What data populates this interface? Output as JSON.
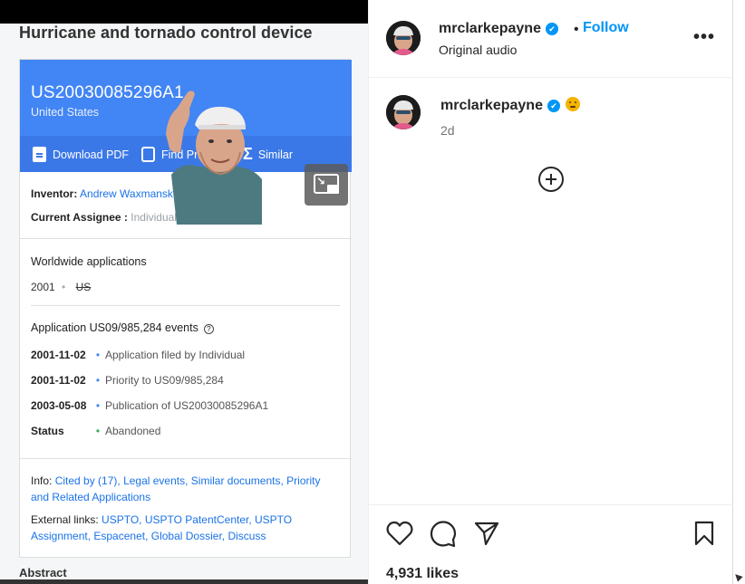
{
  "media": {
    "doc_title": "Hurricane and tornado control device",
    "publication_number": "US20030085296A1",
    "country": "United States",
    "actions": {
      "download_pdf": "Download PDF",
      "find_prior_art": "Find Prior",
      "similar": "Similar"
    },
    "inventor_label": "Inventor:",
    "inventor_value": "Andrew Waxmansk",
    "assignee_label": "Current Assignee :",
    "assignee_value": "Individual",
    "worldwide_title": "Worldwide applications",
    "worldwide_year": "2001",
    "worldwide_dot": "•",
    "worldwide_country": "US",
    "events_title": "Application US09/985,284 events",
    "events_help": "?",
    "events": [
      {
        "date": "2001-11-02",
        "text": "Application filed by Individual"
      },
      {
        "date": "2001-11-02",
        "text": "Priority to US09/985,284"
      },
      {
        "date": "2003-05-08",
        "text": "Publication of US20030085296A1"
      },
      {
        "date": "Status",
        "text": "Abandoned"
      }
    ],
    "event_bullet": "•",
    "info_label": "Info:",
    "info_links": "Cited by (17), Legal events, Similar documents, Priority and Related Applications",
    "external_label": "External links:",
    "external_links": "USPTO, USPTO PatentCenter, USPTO Assignment, Espacenet, Global Dossier, Discuss",
    "abstract_label": "Abstract",
    "icons": {
      "pip": "picture-in-picture-icon",
      "pdf": "pdf-icon",
      "search": "search-icon",
      "sigma": "sigma-icon"
    }
  },
  "post": {
    "username": "mrclarkepayne",
    "verified_mark": "✔",
    "separator": "•",
    "follow_label": "Follow",
    "audio": "Original audio",
    "more_label": "•••",
    "caption_username": "mrclarkepayne",
    "time_ago": "2d",
    "likes": "4,931 likes",
    "icons": {
      "like": "heart-icon",
      "comment": "comment-icon",
      "share": "send-icon",
      "save": "bookmark-icon",
      "add": "plus-circle-icon",
      "emoji": "thinking-face-emoji"
    },
    "colors": {
      "accent": "#0095f6",
      "text": "#262626",
      "muted": "#737373"
    }
  }
}
